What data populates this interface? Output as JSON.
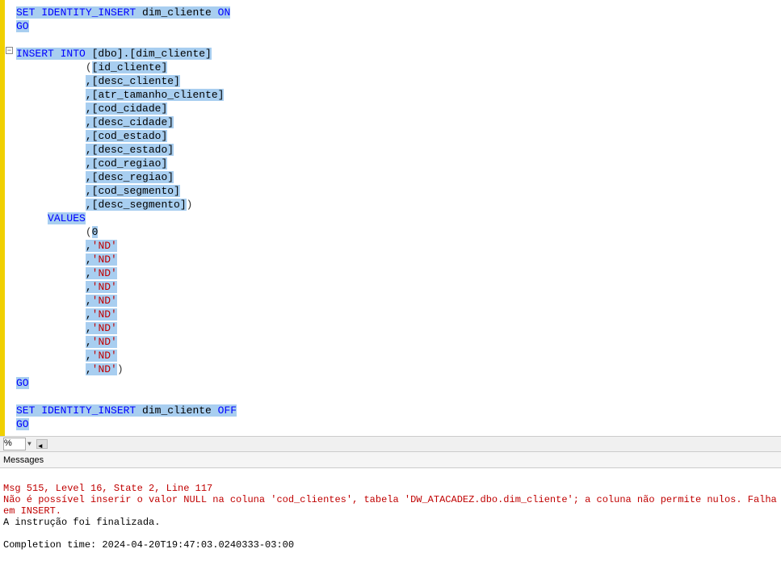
{
  "editor": {
    "line1": {
      "kw1": "SET IDENTITY_INSERT",
      "obj": " dim_cliente ",
      "kw2": "ON"
    },
    "line2": {
      "kw": "GO"
    },
    "line4": {
      "kw": "INSERT INTO",
      "obj": " [dbo].[dim_cliente]"
    },
    "columns": [
      "[id_cliente]",
      "[desc_cliente]",
      "[atr_tamanho_cliente]",
      "[cod_cidade]",
      "[desc_cidade]",
      "[cod_estado]",
      "[desc_estado]",
      "[cod_regiao]",
      "[desc_regiao]",
      "[cod_segmento]",
      "[desc_segmento]"
    ],
    "values_kw": "VALUES",
    "values_first": "0",
    "nd_value": "'ND'",
    "nd_count": 10,
    "go": "GO",
    "line_off": {
      "kw1": "SET IDENTITY_INSERT",
      "obj": " dim_cliente ",
      "kw2": "OFF"
    }
  },
  "zoom": {
    "value": "%"
  },
  "messages": {
    "tab": "Messages",
    "err1": "Msg 515, Level 16, State 2, Line 117",
    "err2": "Não é possível inserir o valor NULL na coluna 'cod_clientes', tabela 'DW_ATACADEZ.dbo.dim_cliente'; a coluna não permite nulos. Falha em INSERT.",
    "plain1": "A instrução foi finalizada.",
    "completion": "Completion time: 2024-04-20T19:47:03.0240333-03:00"
  }
}
